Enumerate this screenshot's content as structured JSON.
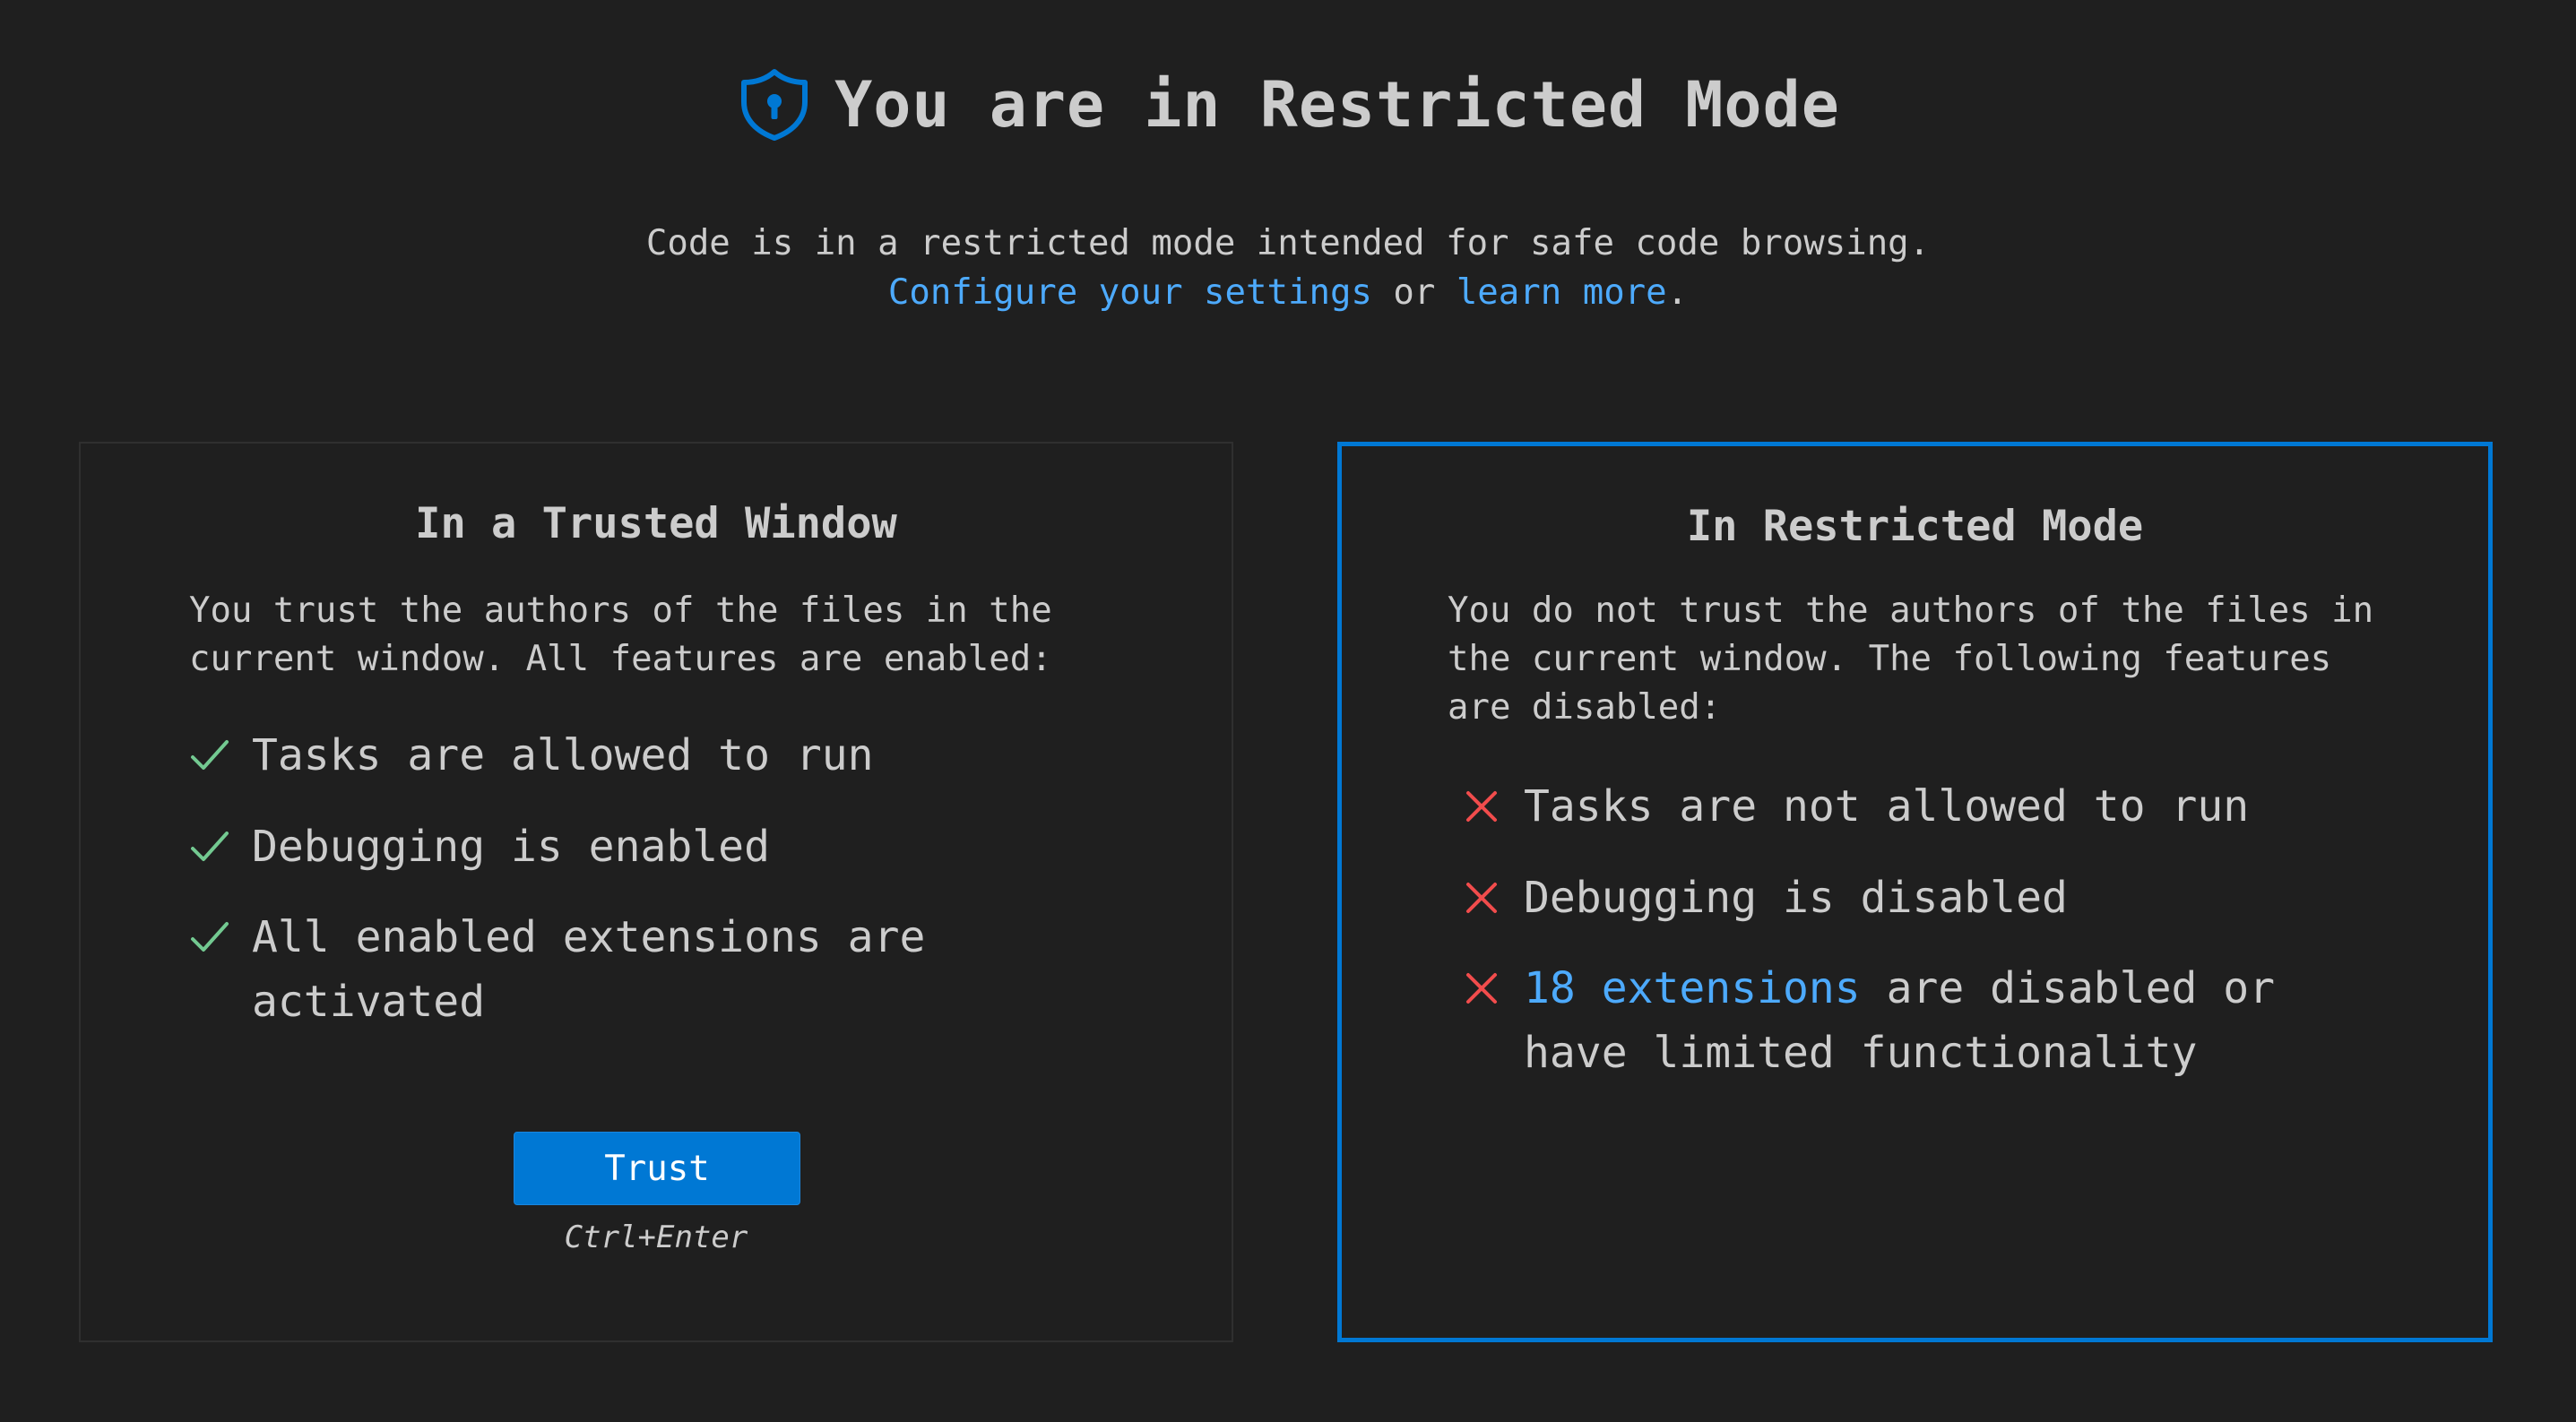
{
  "header": {
    "title": "You are in Restricted Mode",
    "icon": "shield-lock-icon",
    "accent_color": "#0078d4"
  },
  "subtitle": {
    "line1": "Code is in a restricted mode intended for safe code browsing.",
    "configure_link": "Configure your settings",
    "connector": " or ",
    "learn_link": "learn more",
    "end": "."
  },
  "trusted_card": {
    "title": "In a Trusted Window",
    "description": "You trust the authors of the files in the current window. All features are enabled:",
    "features": [
      {
        "icon": "checkmark-icon",
        "text": "Tasks are allowed to run"
      },
      {
        "icon": "checkmark-icon",
        "text": "Debugging is enabled"
      },
      {
        "icon": "checkmark-icon",
        "text": "All enabled extensions are activated"
      }
    ],
    "button_label": "Trust",
    "shortcut": "Ctrl+Enter",
    "check_color": "#73c991"
  },
  "restricted_card": {
    "title": "In Restricted Mode",
    "description": "You do not trust the authors of the files in the current window. The following features are disabled:",
    "features": [
      {
        "icon": "x-icon",
        "text": "Tasks are not allowed to run"
      },
      {
        "icon": "x-icon",
        "text": "Debugging is disabled"
      },
      {
        "icon": "x-icon",
        "link": "18 extensions",
        "text": " are disabled or have limited functionality"
      }
    ],
    "x_color": "#f14c4c",
    "border_color": "#0078d4"
  },
  "colors": {
    "background": "#1f1f1f",
    "text": "#cccccc",
    "link": "#4daafc"
  }
}
